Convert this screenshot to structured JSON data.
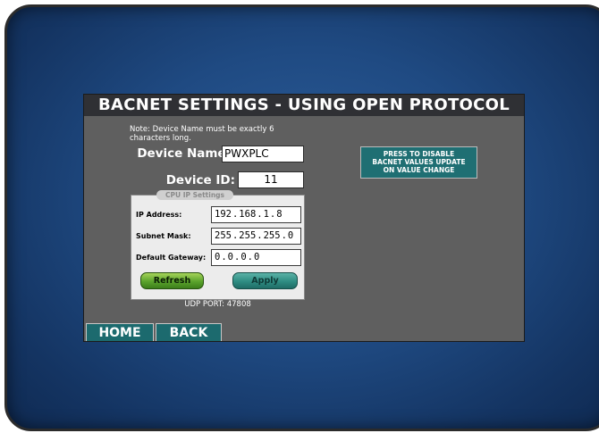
{
  "title": "BACNET SETTINGS - USING OPEN PROTOCOL",
  "note": "Note: Device Name must be exactly 6 characters long.",
  "device_name": {
    "label": "Device Name:",
    "value": "PWXPLC"
  },
  "device_id": {
    "label": "Device ID:",
    "value": "11"
  },
  "cpu_ip_settings": {
    "title": "CPU IP Settings",
    "ip_address": {
      "label": "IP Address:",
      "octets": [
        "192",
        "168",
        "1",
        "8"
      ]
    },
    "subnet_mask": {
      "label": "Subnet Mask:",
      "octets": [
        "255",
        "255",
        "255",
        "0"
      ]
    },
    "default_gateway": {
      "label": "Default Gateway:",
      "octets": [
        "0",
        "0",
        "0",
        "0"
      ]
    },
    "refresh_label": "Refresh",
    "apply_label": "Apply"
  },
  "udp_port": "UDP PORT: 47808",
  "disable_button": {
    "line1": "PRESS TO DISABLE",
    "line2": "BACNET VALUES UPDATE",
    "line3": "ON VALUE CHANGE"
  },
  "nav": {
    "home_label": "HOME",
    "back_label": "BACK"
  },
  "colors": {
    "bezel_blue": "#1f4a82",
    "screen_gray": "#5f5f5f",
    "title_bar": "#2f3034",
    "teal_button": "#1c6a6e",
    "refresh_green": "#5aa32c",
    "apply_teal": "#2e8c82"
  }
}
